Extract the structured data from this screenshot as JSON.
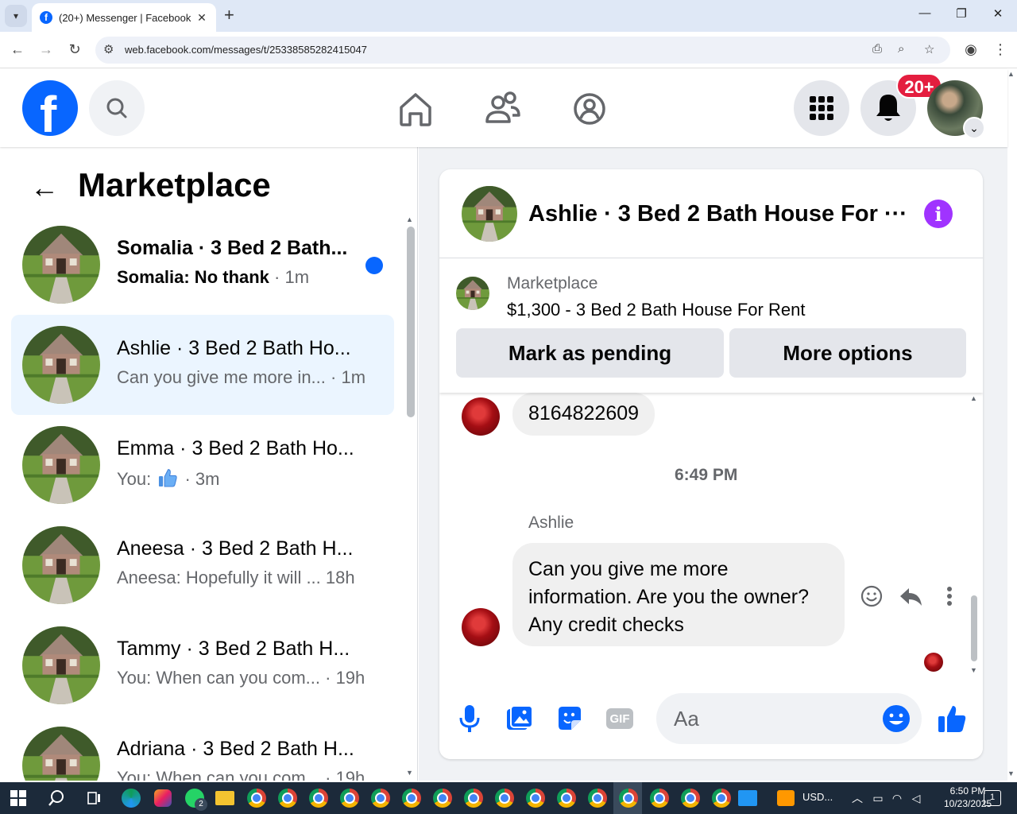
{
  "browser": {
    "tab_title": "(20+) Messenger | Facebook",
    "new_tab_symbol": "+",
    "url": "web.facebook.com/messages/t/25338585282415047"
  },
  "header": {
    "notification_badge": "20+",
    "colors": {
      "brand": "#0866ff",
      "badge": "#e41e3f"
    }
  },
  "sidebar": {
    "title": "Marketplace",
    "conversations": [
      {
        "name": "Somalia · 3 Bed 2 Bath...",
        "preview": "Somalia: No thank",
        "time": "· 1m",
        "unread": true,
        "active": false
      },
      {
        "name": "Ashlie · 3 Bed 2 Bath Ho...",
        "preview": "Can you give me more in...",
        "time": "· 1m",
        "unread": false,
        "active": true
      },
      {
        "name": "Emma · 3 Bed 2 Bath Ho...",
        "preview": "You: ",
        "emoji_icon": "thumbs-up-icon",
        "time": "· 3m",
        "unread": false,
        "active": false
      },
      {
        "name": "Aneesa · 3 Bed 2 Bath H...",
        "preview": "Aneesa: Hopefully it will ...",
        "time": "18h",
        "unread": false,
        "active": false
      },
      {
        "name": "Tammy · 3 Bed 2 Bath H...",
        "preview": "You: When can you com...",
        "time": "· 19h",
        "unread": false,
        "active": false
      },
      {
        "name": "Adriana · 3 Bed 2 Bath H...",
        "preview": "You: When can you com...",
        "time": "· 19h",
        "unread": false,
        "active": false
      }
    ]
  },
  "chat": {
    "title": "Ashlie · 3 Bed 2 Bath House For ···",
    "listing": {
      "source": "Marketplace",
      "title": "$1,300 - 3 Bed 2 Bath House For Rent",
      "mark_pending_label": "Mark as pending",
      "more_options_label": "More options"
    },
    "messages": {
      "previous_message": "8164822609",
      "timestamp": "6:49 PM",
      "sender": "Ashlie",
      "latest_message_lines": [
        "Can you give  me more",
        "information. Are you the owner?",
        "Any credit checks"
      ]
    },
    "composer": {
      "placeholder": "Aa",
      "gif_label": "GIF"
    }
  },
  "taskbar": {
    "whatsapp_badge": "2",
    "currency_widget": "USD...",
    "time": "6:50 PM",
    "date": "10/23/2025",
    "notification_count": "1"
  }
}
